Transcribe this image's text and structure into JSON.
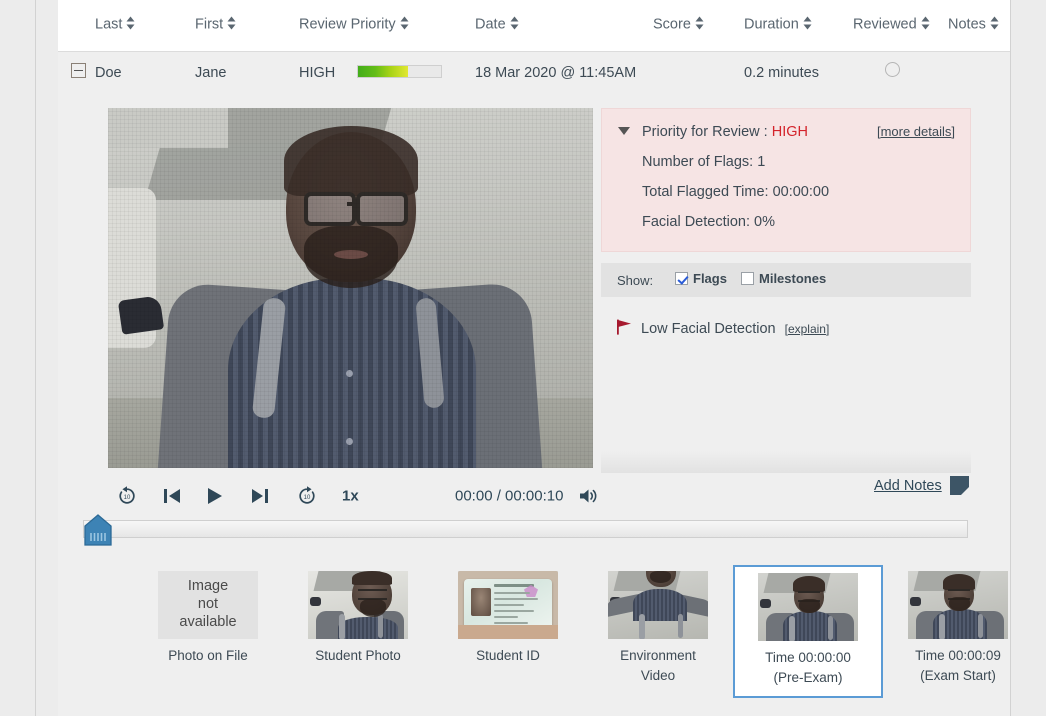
{
  "table": {
    "columns": [
      {
        "label": "Last",
        "sortable": true
      },
      {
        "label": "First",
        "sortable": true
      },
      {
        "label": "Review Priority",
        "sortable": true
      },
      {
        "label": "Date",
        "sortable": true
      },
      {
        "label": "Score",
        "sortable": true
      },
      {
        "label": "Duration",
        "sortable": true
      },
      {
        "label": "Reviewed",
        "sortable": true
      },
      {
        "label": "Notes",
        "sortable": true
      }
    ],
    "row": {
      "last": "Doe",
      "first": "Jane",
      "priority_label": "HIGH",
      "priority_fill_percent": 60,
      "date": "18 Mar 2020 @ 11:45AM",
      "score": "",
      "duration": "0.2 minutes",
      "reviewed": false,
      "notes": ""
    }
  },
  "priority_panel": {
    "title_prefix": "Priority for Review :",
    "title_value": "HIGH",
    "more_details": "[more details]",
    "more_details_text": "more details",
    "number_of_flags": "Number of Flags: 1",
    "total_flagged_time": "Total Flagged Time: 00:00:00",
    "facial_detection": "Facial Detection: 0%",
    "accent_color": "#d4232b",
    "background_color": "#f6e4e4"
  },
  "show_bar": {
    "label": "Show:",
    "flags_label": "Flags",
    "flags_checked": true,
    "milestones_label": "Milestones",
    "milestones_checked": false
  },
  "flags": [
    {
      "name": "Low Facial Detection",
      "explain": "[explain]",
      "explain_text": "explain",
      "color": "#a6192e"
    }
  ],
  "player": {
    "rewind_label": "10",
    "forward_label": "10",
    "speed": "1x",
    "current_time": "00:00",
    "total_time": "00:00:10",
    "timecode": "00:00 / 00:00:10",
    "scrub_position_percent": 0
  },
  "notes": {
    "add_notes_label": "Add Notes"
  },
  "thumbnails": [
    {
      "caption": "Photo on File",
      "caption2": "",
      "unavailable_text": [
        "Image",
        "not",
        "available"
      ],
      "kind": "unavailable",
      "selected": false
    },
    {
      "caption": "Student Photo",
      "caption2": "",
      "kind": "student-photo",
      "selected": false
    },
    {
      "caption": "Student ID",
      "caption2": "",
      "kind": "student-id",
      "selected": false
    },
    {
      "caption": "Environment",
      "caption2": "Video",
      "kind": "environment-video",
      "selected": false
    },
    {
      "caption": "Time 00:00:00",
      "caption2": "(Pre-Exam)",
      "kind": "webcam",
      "selected": true
    },
    {
      "caption": "Time 00:00:09",
      "caption2": "(Exam Start)",
      "kind": "webcam",
      "selected": false
    }
  ]
}
